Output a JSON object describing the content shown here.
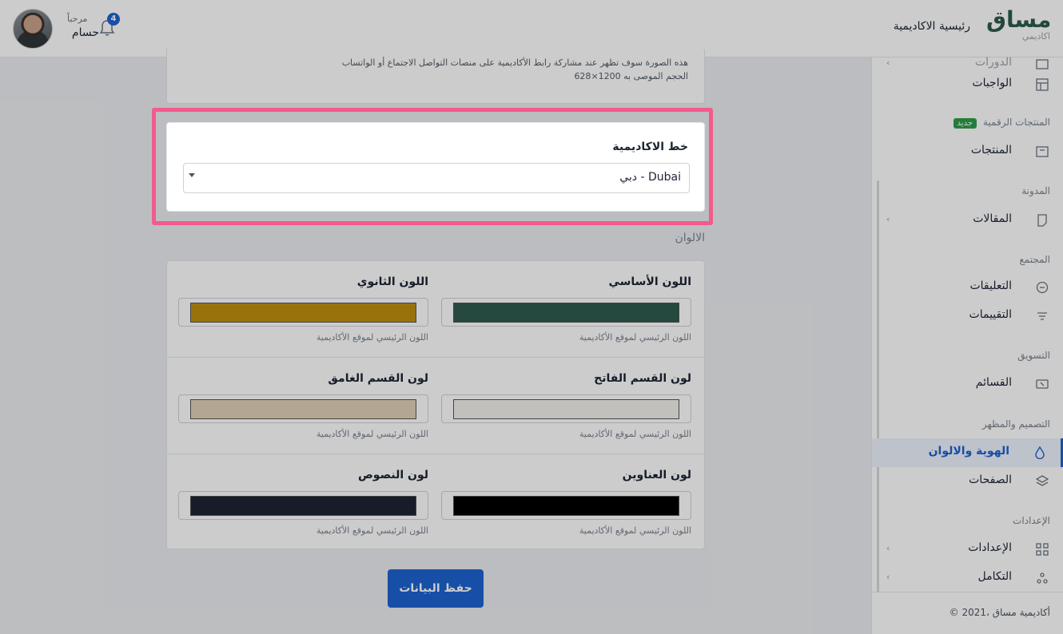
{
  "header": {
    "brand_name": "مساق",
    "brand_sub": "اكاديمي",
    "home_link": "رئيسية الاكاديمية",
    "greeting": "مرحباً",
    "user_name": "حسام",
    "notification_count": "4"
  },
  "sidebar": {
    "top_partial": "الدورات",
    "assignments": "الواجبات",
    "section_digital": "المنتجات الرقمية",
    "new_badge": "جديد",
    "products": "المنتجات",
    "section_blog": "المدونة",
    "articles": "المقالات",
    "section_community": "المجتمع",
    "comments": "التعليقات",
    "reviews": "التقييمات",
    "section_marketing": "التسويق",
    "mailing_lists": "القسائم",
    "section_design": "التصميم والمظهر",
    "identity_colors": "الهوية والالوان",
    "pages": "الصفحات",
    "section_settings": "الإعدادات",
    "settings": "الإعدادات",
    "integration": "التكامل",
    "footer": "© 2021، أكاديمية مساق"
  },
  "main": {
    "top_hint_1": "هذه الصورة سوف تظهر عند مشاركة رابط الأكاديمية على منصات التواصل الاجتماع أو الواتساب",
    "top_hint_2": "الحجم الموصى به 1200×628",
    "font_label": "خط الاكاديمية",
    "font_value": "دبي - Dubai",
    "colors_title": "الالوان",
    "colors": [
      {
        "label": "اللون الأساسي",
        "hint": "اللون الرئيسي لموقع الأكاديمية",
        "color": "#2f5a4f"
      },
      {
        "label": "اللون الثانوي",
        "hint": "اللون الرئيسي لموقع الأكاديمية",
        "color": "#c18f0f"
      },
      {
        "label": "لون القسم الفاتح",
        "hint": "اللون الرئيسي لموقع الأكاديمية",
        "color": "#f2f0ec"
      },
      {
        "label": "لون القسم الغامق",
        "hint": "اللون الرئيسي لموقع الأكاديمية",
        "color": "#e1d1b7"
      },
      {
        "label": "لون العناوين",
        "hint": "اللون الرئيسي لموقع الأكاديمية",
        "color": "#000000"
      },
      {
        "label": "لون النصوص",
        "hint": "اللون الرئيسي لموقع الأكاديمية",
        "color": "#1c2434"
      }
    ],
    "save_label": "حفظ البيانات"
  }
}
